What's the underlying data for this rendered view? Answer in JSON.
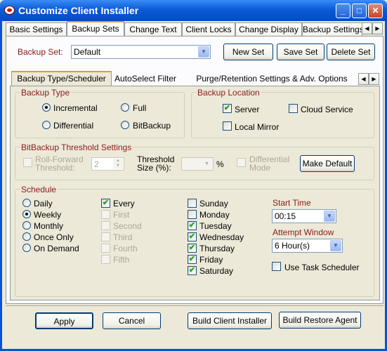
{
  "window": {
    "title": "Customize Client Installer",
    "buttons": {
      "minimize": "_",
      "maximize": "□",
      "close": "✕"
    }
  },
  "main_tabs": [
    "Basic Settings",
    "Backup Sets",
    "Change Text",
    "Client Locks",
    "Change Display",
    "Backup Settings"
  ],
  "backup_set": {
    "label": "Backup Set:",
    "value": "Default",
    "new": "New Set",
    "save": "Save Set",
    "delete": "Delete Set"
  },
  "sub_tabs": [
    "Backup Type/Scheduler",
    "AutoSelect Filter",
    "Purge/Retention Settings & Adv. Options"
  ],
  "backup_type": {
    "title": "Backup Type",
    "options": [
      "Incremental",
      "Full",
      "Differential",
      "BitBackup"
    ],
    "selected": "Incremental"
  },
  "backup_location": {
    "title": "Backup Location",
    "server": "Server",
    "cloud": "Cloud Service",
    "local": "Local Mirror",
    "server_checked": true,
    "cloud_checked": false,
    "local_checked": false
  },
  "bitbackup": {
    "title": "BitBackup Threshold Settings",
    "roll_forward_1": "Roll-Forward",
    "roll_forward_2": "Threshold:",
    "roll_value": "2",
    "threshold_1": "Threshold",
    "threshold_2": "Size (%):",
    "pct": "%",
    "diff_1": "Differential",
    "diff_2": "Mode",
    "make_default": "Make Default"
  },
  "schedule": {
    "title": "Schedule",
    "freq": [
      "Daily",
      "Weekly",
      "Monthly",
      "Once Only",
      "On Demand"
    ],
    "freq_selected": "Weekly",
    "weeks": [
      {
        "label": "Every",
        "checked": true,
        "enabled": true
      },
      {
        "label": "First",
        "checked": false,
        "enabled": false
      },
      {
        "label": "Second",
        "checked": false,
        "enabled": false
      },
      {
        "label": "Third",
        "checked": false,
        "enabled": false
      },
      {
        "label": "Fourth",
        "checked": false,
        "enabled": false
      },
      {
        "label": "Fifth",
        "checked": false,
        "enabled": false
      }
    ],
    "days": [
      {
        "label": "Sunday",
        "checked": false
      },
      {
        "label": "Monday",
        "checked": false
      },
      {
        "label": "Tuesday",
        "checked": true
      },
      {
        "label": "Wednesday",
        "checked": true
      },
      {
        "label": "Thursday",
        "checked": true
      },
      {
        "label": "Friday",
        "checked": true
      },
      {
        "label": "Saturday",
        "checked": true
      }
    ],
    "start_time_label": "Start Time",
    "start_time": "00:15",
    "attempt_label": "Attempt Window",
    "attempt": "6 Hour(s)",
    "use_task": "Use Task Scheduler"
  },
  "footer": {
    "apply": "Apply",
    "cancel": "Cancel",
    "build_client": "Build Client Installer",
    "build_restore": "Build Restore Agent"
  }
}
